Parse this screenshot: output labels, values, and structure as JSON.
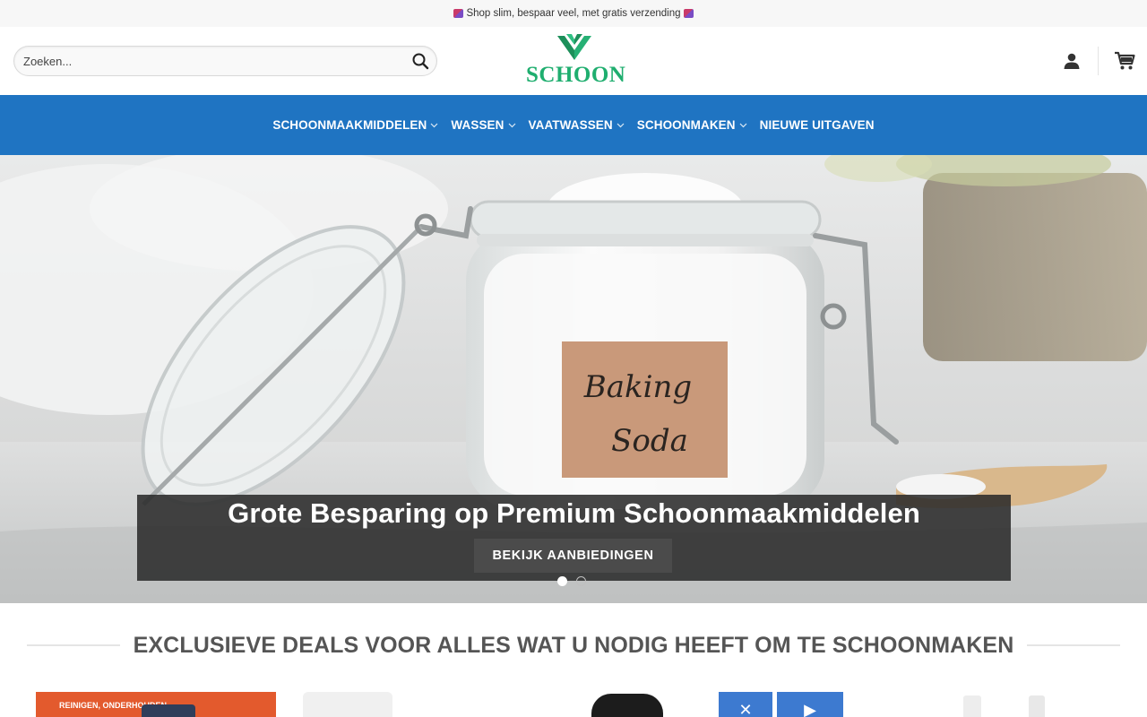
{
  "announcement": {
    "text": "Shop slim, bespaar veel, met gratis verzending",
    "icon": "shopping-bags-icon"
  },
  "header": {
    "search": {
      "placeholder": "Zoeken...",
      "value": ""
    },
    "logo_text": "SCHOON",
    "icons": [
      "search-icon",
      "account-icon",
      "cart-icon"
    ],
    "colors": {
      "logo_green": "#1fae6f"
    }
  },
  "nav": {
    "background": "#1f74c2",
    "items": [
      {
        "label": "SCHOONMAAKMIDDELEN",
        "has_dropdown": true
      },
      {
        "label": "WASSEN",
        "has_dropdown": true
      },
      {
        "label": "VAATWASSEN",
        "has_dropdown": true
      },
      {
        "label": "SCHOONMAKEN",
        "has_dropdown": true
      },
      {
        "label": "NIEUWE UITGAVEN",
        "has_dropdown": false
      }
    ]
  },
  "hero": {
    "jar_label_line1": "Baking",
    "jar_label_line2": "Soda",
    "title": "Grote Besparing op Premium Schoonmaakmiddelen",
    "cta_label": "BEKIJK AANBIEDINGEN",
    "slides": 2,
    "active_slide": 1
  },
  "deals": {
    "title": "EXCLUSIEVE DEALS VOOR ALLES WAT U NODIG HEEFT OM TE SCHOONMAKEN",
    "products": [
      {
        "visible_text": "REINIGEN, ONDERHOUDEN"
      },
      {
        "visible_text": ""
      },
      {
        "visible_text": ""
      },
      {
        "visible_text": ""
      },
      {
        "visible_text": ""
      }
    ]
  }
}
